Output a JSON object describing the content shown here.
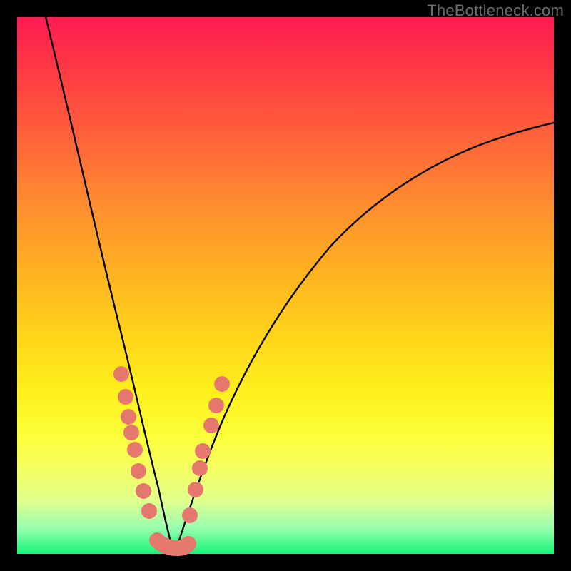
{
  "watermark": "TheBottleneck.com",
  "colors": {
    "dot": "#e5776e",
    "curve": "#000000",
    "gradient_top": "#ff1b52",
    "gradient_bottom": "#15f57a",
    "background": "#000000"
  },
  "chart_data": {
    "type": "line",
    "title": "",
    "xlabel": "",
    "ylabel": "",
    "xlim": [
      0,
      100
    ],
    "ylim": [
      0,
      100
    ],
    "grid": false,
    "legend": false,
    "note": "Two black curves descending into a V near x≈27 (y≈0) then the right branch rises back toward ~70% height at the right edge. Salmon dots cluster on both branches near the intersection and along the bottom.",
    "series": [
      {
        "name": "left-curve",
        "x": [
          5,
          7,
          9,
          11,
          13,
          15,
          17,
          19,
          21,
          23,
          25,
          27
        ],
        "y": [
          100,
          90,
          80,
          70,
          60,
          50,
          40,
          30,
          20,
          12,
          5,
          0
        ]
      },
      {
        "name": "right-curve",
        "x": [
          27,
          30,
          34,
          38,
          42,
          47,
          53,
          60,
          68,
          77,
          87,
          100
        ],
        "y": [
          0,
          8,
          18,
          27,
          35,
          42,
          49,
          55,
          60,
          64,
          67,
          70
        ]
      }
    ],
    "points": [
      {
        "x": 18.0,
        "y": 34
      },
      {
        "x": 19.0,
        "y": 29
      },
      {
        "x": 19.8,
        "y": 25
      },
      {
        "x": 20.0,
        "y": 22
      },
      {
        "x": 20.8,
        "y": 19
      },
      {
        "x": 21.4,
        "y": 15
      },
      {
        "x": 22.4,
        "y": 11
      },
      {
        "x": 23.3,
        "y": 8
      },
      {
        "x": 25.0,
        "y": 2
      },
      {
        "x": 27.0,
        "y": 1
      },
      {
        "x": 29.0,
        "y": 1
      },
      {
        "x": 30.5,
        "y": 2
      },
      {
        "x": 31.0,
        "y": 7
      },
      {
        "x": 32.0,
        "y": 12
      },
      {
        "x": 33.0,
        "y": 16
      },
      {
        "x": 33.3,
        "y": 19
      },
      {
        "x": 35.0,
        "y": 24
      },
      {
        "x": 36.0,
        "y": 28
      },
      {
        "x": 37.0,
        "y": 32
      }
    ]
  }
}
